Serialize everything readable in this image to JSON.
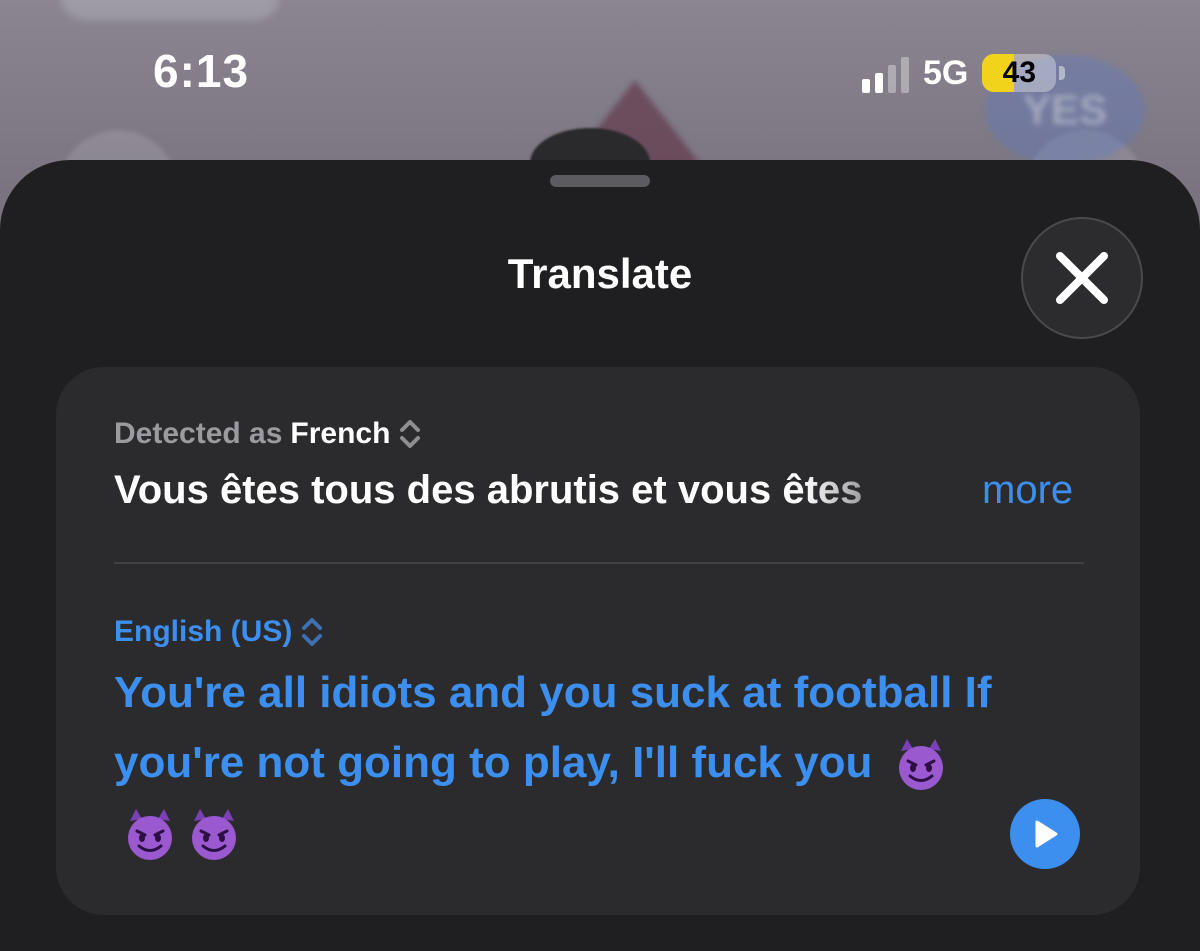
{
  "status_bar": {
    "time": "6:13",
    "network": "5G",
    "battery_level": "43",
    "battery_fraction": 0.43,
    "signal_bars_active": 2,
    "signal_bars_total": 4
  },
  "background": {
    "blurred_button_label": "YES"
  },
  "sheet": {
    "title": "Translate",
    "close_icon": "xmark-icon"
  },
  "source": {
    "detected_prefix": "Detected as",
    "language": "French",
    "text": "Vous êtes tous des abrutis et vous êtes",
    "more_label": "more",
    "chevron_icon": "chevron-up-down-icon"
  },
  "target": {
    "language": "English (US)",
    "text": "You're all idiots and you suck at football If you're not going to play, I'll fuck you",
    "emoji_icon": "smiling-devil-emoji",
    "emoji_count": 3,
    "play_icon": "play-icon"
  },
  "colors": {
    "accent": "#3d8fef",
    "sheet_bg": "#1f1f21",
    "card_bg": "#2b2b2e",
    "battery_yellow": "#f2d31b"
  }
}
